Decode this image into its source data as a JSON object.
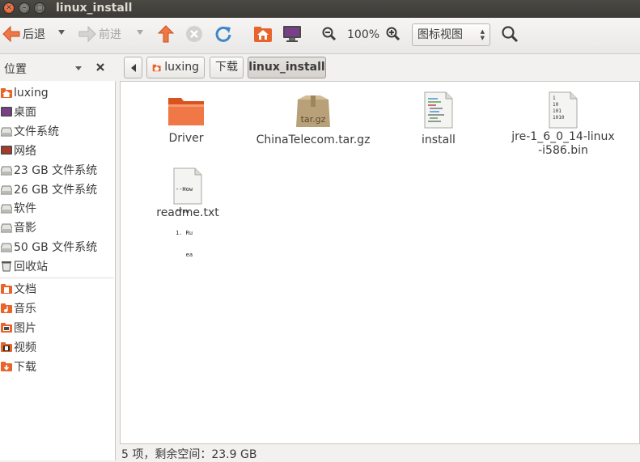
{
  "window": {
    "title": "linux_install"
  },
  "toolbar": {
    "back_label": "后退",
    "forward_label": "前进",
    "zoom_level": "100%",
    "view_mode": "图标视图"
  },
  "sidebar": {
    "title": "位置",
    "items": [
      {
        "label": "luxing",
        "icon": "home-folder-icon"
      },
      {
        "label": "桌面",
        "icon": "desktop-icon"
      },
      {
        "label": "文件系统",
        "icon": "drive-icon"
      },
      {
        "label": "网络",
        "icon": "network-icon"
      },
      {
        "label": "23 GB 文件系统",
        "icon": "drive-icon"
      },
      {
        "label": "26 GB 文件系统",
        "icon": "drive-icon"
      },
      {
        "label": "软件",
        "icon": "drive-icon"
      },
      {
        "label": "音影",
        "icon": "drive-icon"
      },
      {
        "label": "50 GB 文件系统",
        "icon": "drive-icon"
      },
      {
        "label": "回收站",
        "icon": "trash-icon"
      },
      {
        "label": "文档",
        "icon": "documents-folder-icon"
      },
      {
        "label": "音乐",
        "icon": "music-folder-icon"
      },
      {
        "label": "图片",
        "icon": "pictures-folder-icon"
      },
      {
        "label": "视频",
        "icon": "videos-folder-icon"
      },
      {
        "label": "下载",
        "icon": "downloads-folder-icon"
      }
    ]
  },
  "breadcrumb": {
    "items": [
      "luxing",
      "下载",
      "linux_install"
    ]
  },
  "files": [
    {
      "name": "Driver",
      "icon": "folder-icon"
    },
    {
      "name": "ChinaTelecom.tar.gz",
      "icon": "archive-icon",
      "badge": "tar.gz"
    },
    {
      "name": "install",
      "icon": "script-file-icon"
    },
    {
      "name": "jre-1_6_0_14-linux-i586.bin",
      "icon": "binary-file-icon",
      "preview": [
        "1",
        "10",
        "101",
        "1010"
      ]
    },
    {
      "name": "readme.txt",
      "icon": "text-file-icon",
      "preview": [
        "--How",
        "*You",
        "1. Ru",
        "   ea"
      ]
    }
  ],
  "status": {
    "text": "5 项，剩余空间：23.9 GB"
  }
}
